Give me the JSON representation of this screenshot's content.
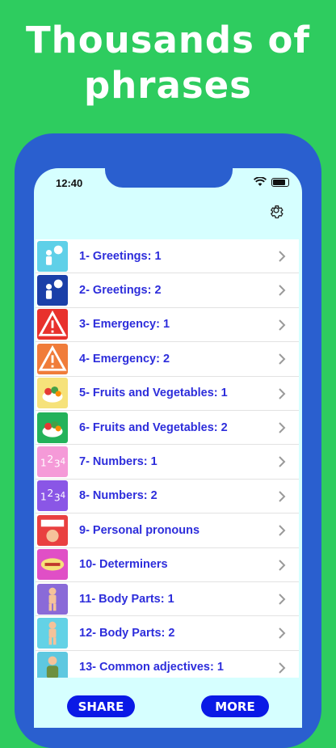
{
  "headline": "Thousands of phrases",
  "status": {
    "time": "12:40"
  },
  "list": [
    {
      "label": "1- Greetings: 1",
      "thumb_color": "#5fd0e8",
      "icon": "person-speech-icon"
    },
    {
      "label": "2- Greetings: 2",
      "thumb_color": "#1a3fa8",
      "icon": "person-speech-icon"
    },
    {
      "label": "3- Emergency: 1",
      "thumb_color": "#e8312c",
      "icon": "warning-icon"
    },
    {
      "label": "4- Emergency: 2",
      "thumb_color": "#f07c3a",
      "icon": "warning-icon"
    },
    {
      "label": "5- Fruits and Vegetables: 1",
      "thumb_color": "#f6e27a",
      "icon": "fruit-bowl-icon"
    },
    {
      "label": "6- Fruits and Vegetables: 2",
      "thumb_color": "#23b25a",
      "icon": "fruit-bowl-icon"
    },
    {
      "label": "7- Numbers: 1",
      "thumb_color": "#f59ad8",
      "icon": "numbers-icon"
    },
    {
      "label": "8- Numbers: 2",
      "thumb_color": "#8a56e6",
      "icon": "numbers-icon"
    },
    {
      "label": "9- Personal pronouns",
      "thumb_color": "#e94040",
      "icon": "pronoun-badge-icon"
    },
    {
      "label": "10- Determiners",
      "thumb_color": "#e04fc6",
      "icon": "determiner-badge-icon"
    },
    {
      "label": "11- Body Parts: 1",
      "thumb_color": "#8a6ad8",
      "icon": "body-figure-icon"
    },
    {
      "label": "12- Body Parts: 2",
      "thumb_color": "#63d2e6",
      "icon": "body-figure-icon"
    },
    {
      "label": "13- Common adjectives: 1",
      "thumb_color": "#5ec8e0",
      "icon": "person-figure-icon"
    }
  ],
  "buttons": {
    "share": "SHARE",
    "more": "MORE"
  },
  "colors": {
    "background": "#2ecc5f",
    "frame": "#2a5fcf",
    "screen": "#d6ffff",
    "label": "#2d2ddb",
    "button": "#0a19e6"
  }
}
